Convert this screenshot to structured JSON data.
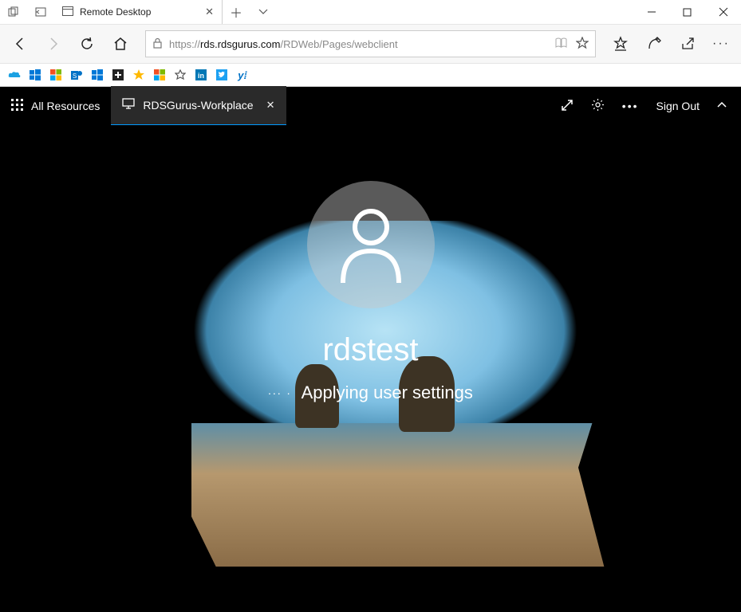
{
  "browser": {
    "tab_title": "Remote Desktop",
    "url_prefix": "https://",
    "url_host": "rds.rdsgurus.com",
    "url_path": "/RDWeb/Pages/webclient"
  },
  "app_header": {
    "all_resources_label": "All Resources",
    "active_tab_label": "RDSGurus-Workplace",
    "sign_out_label": "Sign Out"
  },
  "login": {
    "username": "rdstest",
    "status": "Applying user settings"
  },
  "icons": {
    "grid": "grid-icon",
    "monitor": "monitor-icon",
    "expand": "expand-icon",
    "gear": "gear-icon",
    "more": "more-icon",
    "chevron_up": "chevron-up-icon"
  }
}
